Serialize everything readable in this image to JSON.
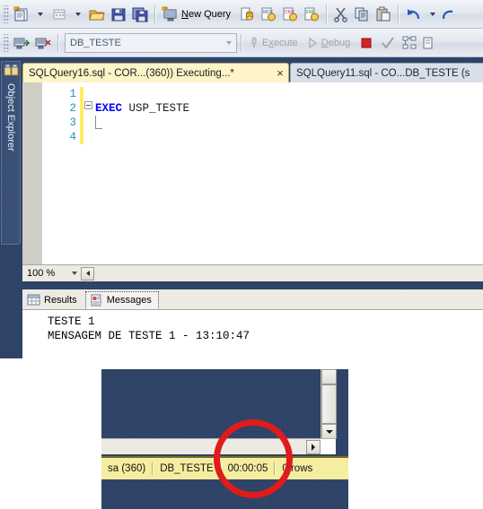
{
  "toolbar_row1": {
    "items": [
      {
        "name": "new-project-button",
        "icon": "new-project-icon",
        "label": ""
      },
      {
        "name": "new-project-dropdown",
        "icon": "chevron-down-icon",
        "label": ""
      },
      {
        "name": "new-table-button",
        "icon": "new-table-icon",
        "label": ""
      },
      {
        "name": "new-table-dropdown",
        "icon": "chevron-down-icon",
        "label": ""
      },
      {
        "name": "open-file-button",
        "icon": "open-folder-icon",
        "label": ""
      },
      {
        "name": "save-button",
        "icon": "save-icon",
        "label": ""
      },
      {
        "name": "save-all-button",
        "icon": "save-all-icon",
        "label": ""
      }
    ],
    "new_query_label": "New Query",
    "new_query_accesskey": "N",
    "database_engine_query_tip": "Database Engine Query",
    "analysis_mdx_label": "MDX",
    "analysis_dmx_label": "DMX",
    "analysis_xmla_label": "XMLA",
    "cut_label": "Cut",
    "copy_label": "Copy",
    "paste_label": "Paste",
    "undo_label": "Undo"
  },
  "toolbar_row2": {
    "connect_label": "Connect",
    "disconnect_label": "Disconnect",
    "database_combo_value": "DB_TESTE",
    "execute_label": "Execute",
    "execute_accesskey": "x",
    "execute_enabled": false,
    "debug_label": "Debug",
    "debug_accesskey": "D",
    "debug_enabled": false,
    "stop_label": "Cancel Executing Query",
    "parse_label": "Parse",
    "display_plan_label": "Display Estimated Execution Plan"
  },
  "object_explorer": {
    "title": "Object Explorer",
    "icon": "object-explorer-icon"
  },
  "document_tabs": [
    {
      "name": "tab-sqlquery16",
      "label": "SQLQuery16.sql - COR...(360)) Executing...*",
      "active": true,
      "close_glyph": "×"
    },
    {
      "name": "tab-sqlquery11",
      "label": "SQLQuery11.sql - CO...DB_TESTE (s",
      "active": false
    }
  ],
  "editor": {
    "line_numbers": [
      "1",
      "2",
      "3",
      "4"
    ],
    "lines": [
      {
        "number": "1",
        "keyword": "",
        "rest": ""
      },
      {
        "number": "2",
        "keyword": "EXEC",
        "rest": " USP_TESTE"
      },
      {
        "number": "3",
        "keyword": "",
        "rest": ""
      },
      {
        "number": "4",
        "keyword": "",
        "rest": ""
      }
    ],
    "fold_glyph": "-"
  },
  "zoombar": {
    "zoom_value": "100 %",
    "scroll_left_glyph": "◄"
  },
  "results_tabs": [
    {
      "name": "tab-results",
      "label": "Results",
      "icon": "grid-icon",
      "active": false
    },
    {
      "name": "tab-messages",
      "label": "Messages",
      "icon": "messages-icon",
      "active": true
    }
  ],
  "messages": [
    "TESTE 1",
    "MENSAGEM DE TESTE 1 - 13:10:47"
  ],
  "statusbar": {
    "user": "sa (360)",
    "database": "DB_TESTE",
    "elapsed": "00:00:05",
    "rows": "0 rows"
  },
  "annotation": {
    "shape": "ellipse",
    "color": "#e01b1b",
    "target": "elapsed-time"
  },
  "colors": {
    "accent_tab": "#fdf4c8",
    "ide_background": "#2e4265",
    "statusbar_executing": "#f5eda0",
    "keyword": "#0000ff",
    "linenumber": "#2b91af",
    "change_bar": "#ffee62",
    "annotation_red": "#e01b1b"
  }
}
